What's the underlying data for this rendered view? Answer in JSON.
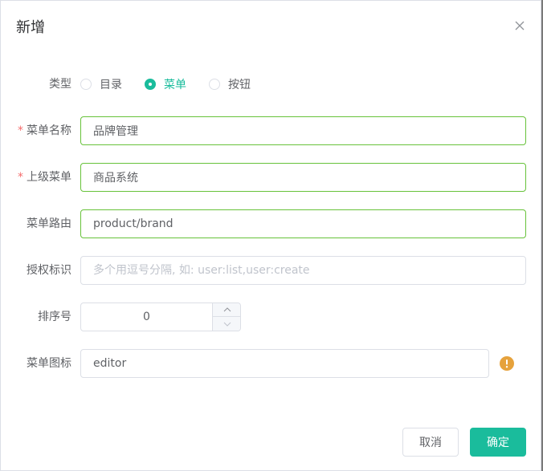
{
  "dialog": {
    "title": "新增",
    "close_icon": "close-icon"
  },
  "type_field": {
    "label": "类型",
    "options": [
      {
        "label": "目录",
        "checked": false
      },
      {
        "label": "菜单",
        "checked": true
      },
      {
        "label": "按钮",
        "checked": false
      }
    ]
  },
  "menu_name": {
    "required_mark": "*",
    "label": "菜单名称",
    "value": "品牌管理"
  },
  "parent_menu": {
    "required_mark": "*",
    "label": "上级菜单",
    "value": "商品系统"
  },
  "menu_route": {
    "label": "菜单路由",
    "value": "product/brand"
  },
  "permission": {
    "label": "授权标识",
    "value": "",
    "placeholder": "多个用逗号分隔, 如: user:list,user:create"
  },
  "sort_order": {
    "label": "排序号",
    "value": "0"
  },
  "menu_icon": {
    "label": "菜单图标",
    "value": "editor",
    "help_icon": "warning-icon"
  },
  "footer": {
    "cancel_label": "取消",
    "confirm_label": "确定"
  },
  "colors": {
    "accent": "#1abc9c",
    "valid_border": "#67c23a",
    "required": "#f56c6c",
    "warning": "#e6a23c"
  }
}
